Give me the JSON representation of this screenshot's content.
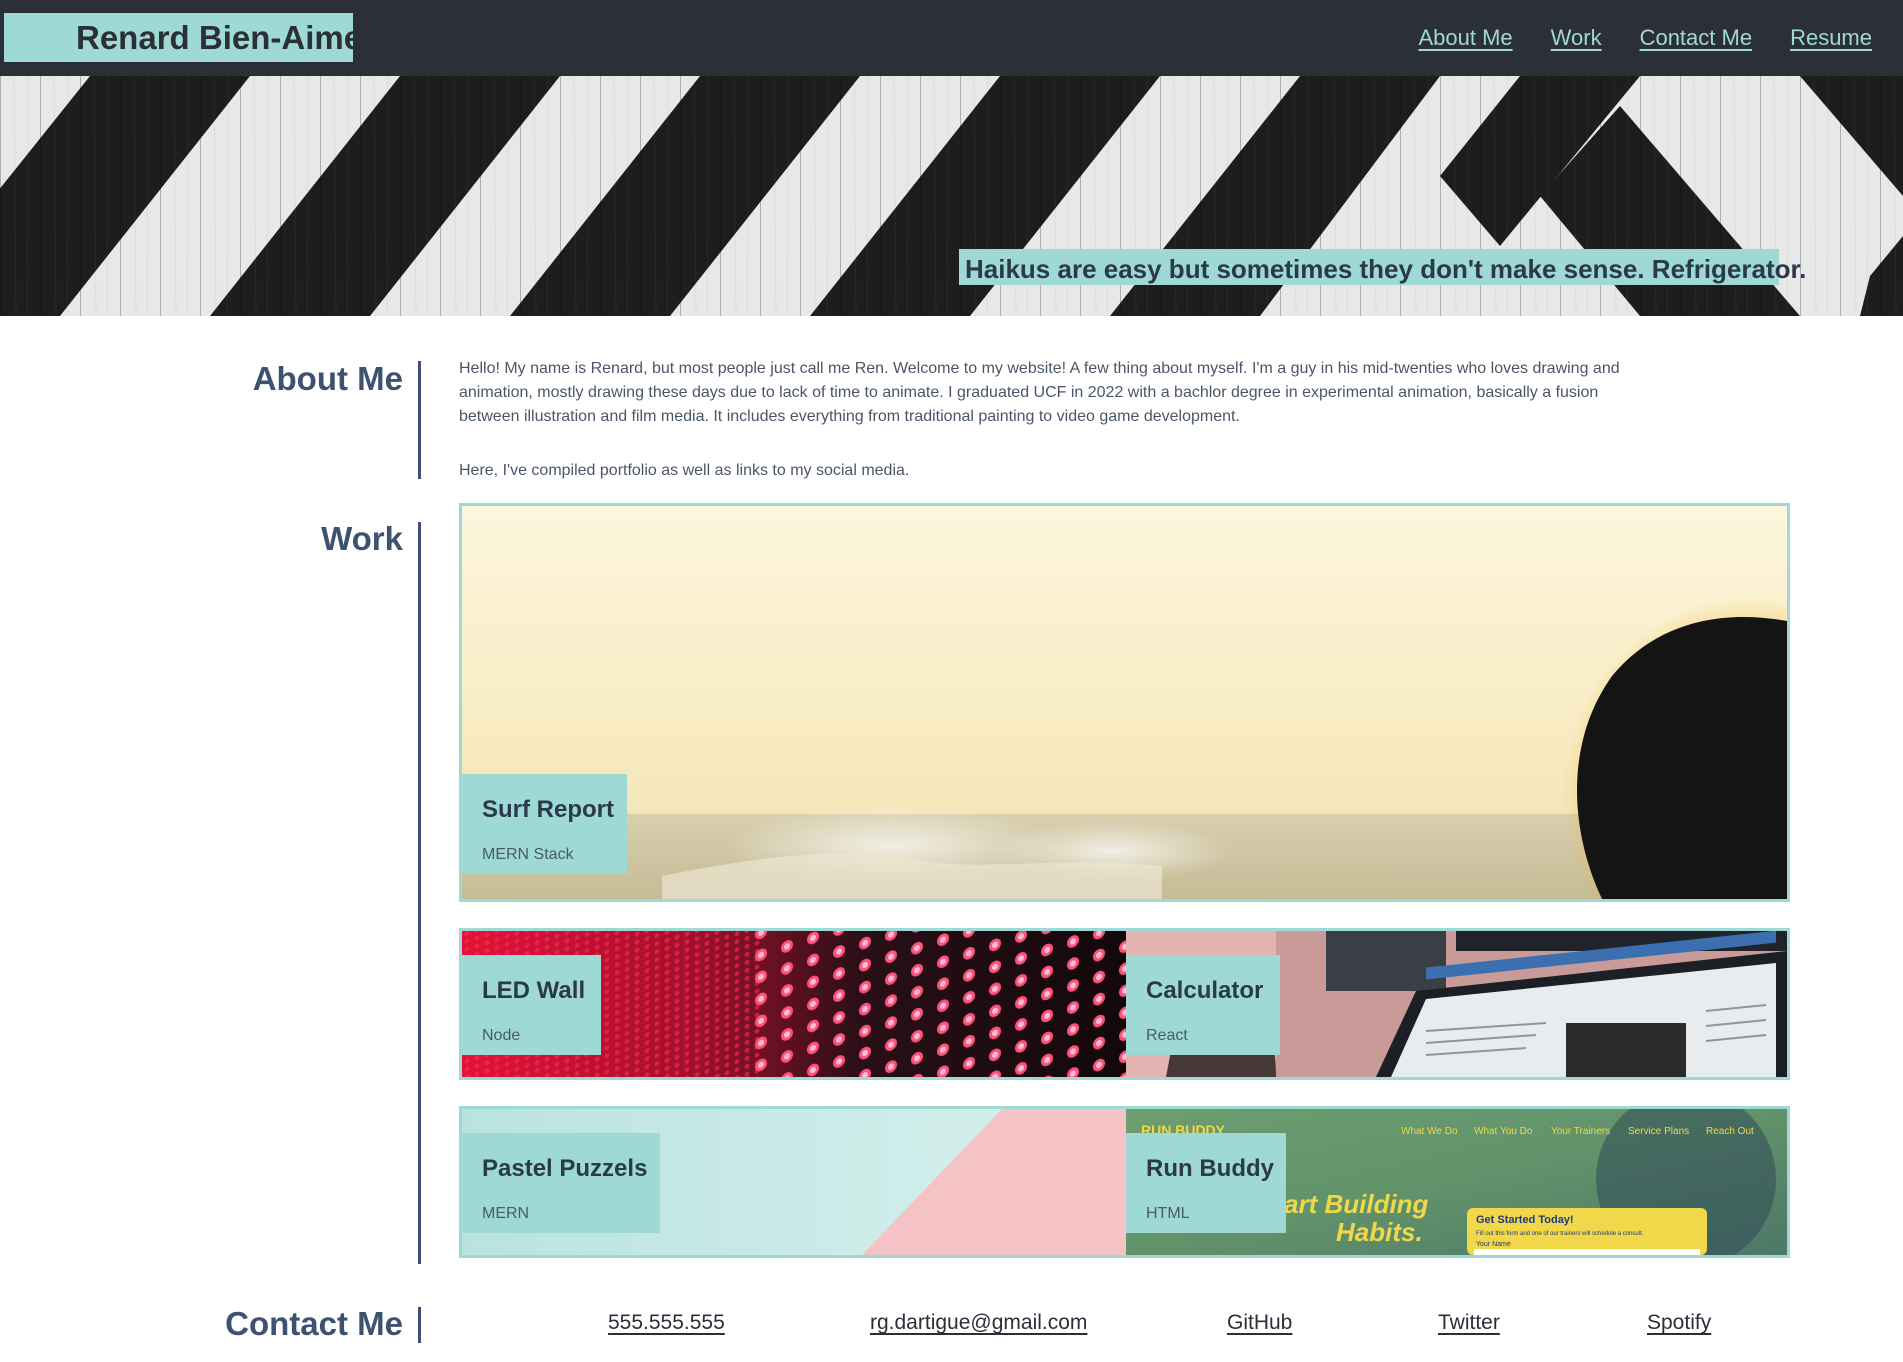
{
  "header": {
    "site_name": "Renard Bien-Aime",
    "nav": [
      {
        "label": "About Me"
      },
      {
        "label": "Work"
      },
      {
        "label": "Contact Me"
      },
      {
        "label": "Resume"
      }
    ]
  },
  "hero": {
    "tagline": "Haikus are easy but sometimes they don't make sense. Refrigerator."
  },
  "about": {
    "title": "About Me",
    "paragraph1": "Hello! My name is Renard, but most people just call me Ren. Welcome to my website! A few thing about myself. I'm a guy in his mid-twenties who loves drawing and animation, mostly drawing these days due to lack of time to animate. I graduated UCF in 2022 with a bachlor degree in experimental animation, basically a fusion between illustration and film media. It includes everything from traditional painting to video game development.",
    "paragraph2": "Here, I've compiled portfolio as well as links to my social media."
  },
  "work": {
    "title": "Work",
    "projects": [
      {
        "name": "Surf Report",
        "stack": "MERN Stack"
      },
      {
        "name": "LED Wall",
        "stack": "Node"
      },
      {
        "name": "Calculator",
        "stack": "React"
      },
      {
        "name": "Pastel Puzzels",
        "stack": "MERN"
      },
      {
        "name": "Run Buddy",
        "stack": "HTML"
      }
    ],
    "run_buddy_preview": {
      "brand": "RUN BUDDY",
      "nav": [
        "What We Do",
        "What You Do",
        "Your Trainers",
        "Service Plans",
        "Reach Out"
      ],
      "headline_line1": "art Building",
      "headline_line2": "Habits.",
      "cta_title": "Get Started Today!",
      "cta_text": "Fill out this form and one of our trainers will schedule a consult.",
      "field_label": "Your Name"
    }
  },
  "contact": {
    "title": "Contact Me",
    "links": [
      {
        "label": "555.555.555"
      },
      {
        "label": "rg.dartigue@gmail.com"
      },
      {
        "label": "GitHub"
      },
      {
        "label": "Twitter"
      },
      {
        "label": "Spotify"
      }
    ]
  },
  "colors": {
    "accent": "#9ed9d5",
    "header_bg": "#2b2f38",
    "heading": "#3d5170"
  }
}
